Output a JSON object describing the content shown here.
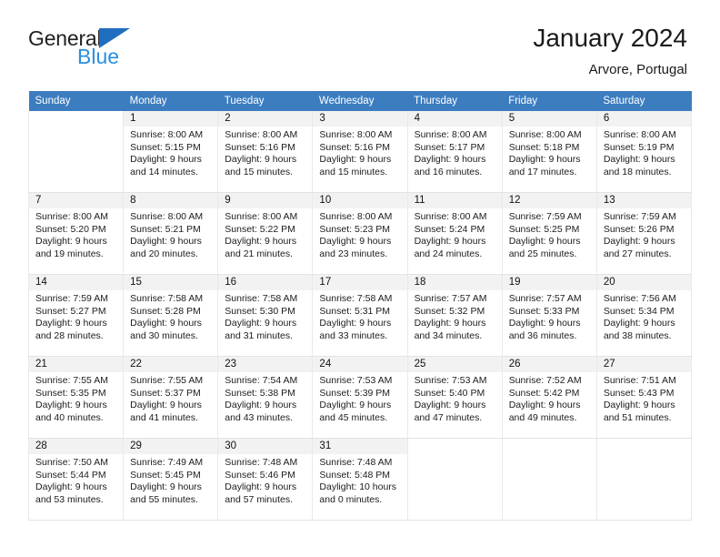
{
  "brand": {
    "name_part1": "General",
    "name_part2": "Blue",
    "logo_icon": "triangle-logo-icon"
  },
  "header": {
    "title": "January 2024",
    "subtitle": "Arvore, Portugal"
  },
  "calendar": {
    "weekday_headers": [
      "Sunday",
      "Monday",
      "Tuesday",
      "Wednesday",
      "Thursday",
      "Friday",
      "Saturday"
    ],
    "accent_color": "#3c7dc0",
    "daynum_band_color": "#f2f2f2",
    "grid_line_color": "#e9e9e9",
    "weeks": [
      [
        {
          "empty": true
        },
        {
          "day": "1",
          "sunrise": "Sunrise: 8:00 AM",
          "sunset": "Sunset: 5:15 PM",
          "daylight1": "Daylight: 9 hours",
          "daylight2": "and 14 minutes."
        },
        {
          "day": "2",
          "sunrise": "Sunrise: 8:00 AM",
          "sunset": "Sunset: 5:16 PM",
          "daylight1": "Daylight: 9 hours",
          "daylight2": "and 15 minutes."
        },
        {
          "day": "3",
          "sunrise": "Sunrise: 8:00 AM",
          "sunset": "Sunset: 5:16 PM",
          "daylight1": "Daylight: 9 hours",
          "daylight2": "and 15 minutes."
        },
        {
          "day": "4",
          "sunrise": "Sunrise: 8:00 AM",
          "sunset": "Sunset: 5:17 PM",
          "daylight1": "Daylight: 9 hours",
          "daylight2": "and 16 minutes."
        },
        {
          "day": "5",
          "sunrise": "Sunrise: 8:00 AM",
          "sunset": "Sunset: 5:18 PM",
          "daylight1": "Daylight: 9 hours",
          "daylight2": "and 17 minutes."
        },
        {
          "day": "6",
          "sunrise": "Sunrise: 8:00 AM",
          "sunset": "Sunset: 5:19 PM",
          "daylight1": "Daylight: 9 hours",
          "daylight2": "and 18 minutes."
        }
      ],
      [
        {
          "day": "7",
          "sunrise": "Sunrise: 8:00 AM",
          "sunset": "Sunset: 5:20 PM",
          "daylight1": "Daylight: 9 hours",
          "daylight2": "and 19 minutes."
        },
        {
          "day": "8",
          "sunrise": "Sunrise: 8:00 AM",
          "sunset": "Sunset: 5:21 PM",
          "daylight1": "Daylight: 9 hours",
          "daylight2": "and 20 minutes."
        },
        {
          "day": "9",
          "sunrise": "Sunrise: 8:00 AM",
          "sunset": "Sunset: 5:22 PM",
          "daylight1": "Daylight: 9 hours",
          "daylight2": "and 21 minutes."
        },
        {
          "day": "10",
          "sunrise": "Sunrise: 8:00 AM",
          "sunset": "Sunset: 5:23 PM",
          "daylight1": "Daylight: 9 hours",
          "daylight2": "and 23 minutes."
        },
        {
          "day": "11",
          "sunrise": "Sunrise: 8:00 AM",
          "sunset": "Sunset: 5:24 PM",
          "daylight1": "Daylight: 9 hours",
          "daylight2": "and 24 minutes."
        },
        {
          "day": "12",
          "sunrise": "Sunrise: 7:59 AM",
          "sunset": "Sunset: 5:25 PM",
          "daylight1": "Daylight: 9 hours",
          "daylight2": "and 25 minutes."
        },
        {
          "day": "13",
          "sunrise": "Sunrise: 7:59 AM",
          "sunset": "Sunset: 5:26 PM",
          "daylight1": "Daylight: 9 hours",
          "daylight2": "and 27 minutes."
        }
      ],
      [
        {
          "day": "14",
          "sunrise": "Sunrise: 7:59 AM",
          "sunset": "Sunset: 5:27 PM",
          "daylight1": "Daylight: 9 hours",
          "daylight2": "and 28 minutes."
        },
        {
          "day": "15",
          "sunrise": "Sunrise: 7:58 AM",
          "sunset": "Sunset: 5:28 PM",
          "daylight1": "Daylight: 9 hours",
          "daylight2": "and 30 minutes."
        },
        {
          "day": "16",
          "sunrise": "Sunrise: 7:58 AM",
          "sunset": "Sunset: 5:30 PM",
          "daylight1": "Daylight: 9 hours",
          "daylight2": "and 31 minutes."
        },
        {
          "day": "17",
          "sunrise": "Sunrise: 7:58 AM",
          "sunset": "Sunset: 5:31 PM",
          "daylight1": "Daylight: 9 hours",
          "daylight2": "and 33 minutes."
        },
        {
          "day": "18",
          "sunrise": "Sunrise: 7:57 AM",
          "sunset": "Sunset: 5:32 PM",
          "daylight1": "Daylight: 9 hours",
          "daylight2": "and 34 minutes."
        },
        {
          "day": "19",
          "sunrise": "Sunrise: 7:57 AM",
          "sunset": "Sunset: 5:33 PM",
          "daylight1": "Daylight: 9 hours",
          "daylight2": "and 36 minutes."
        },
        {
          "day": "20",
          "sunrise": "Sunrise: 7:56 AM",
          "sunset": "Sunset: 5:34 PM",
          "daylight1": "Daylight: 9 hours",
          "daylight2": "and 38 minutes."
        }
      ],
      [
        {
          "day": "21",
          "sunrise": "Sunrise: 7:55 AM",
          "sunset": "Sunset: 5:35 PM",
          "daylight1": "Daylight: 9 hours",
          "daylight2": "and 40 minutes."
        },
        {
          "day": "22",
          "sunrise": "Sunrise: 7:55 AM",
          "sunset": "Sunset: 5:37 PM",
          "daylight1": "Daylight: 9 hours",
          "daylight2": "and 41 minutes."
        },
        {
          "day": "23",
          "sunrise": "Sunrise: 7:54 AM",
          "sunset": "Sunset: 5:38 PM",
          "daylight1": "Daylight: 9 hours",
          "daylight2": "and 43 minutes."
        },
        {
          "day": "24",
          "sunrise": "Sunrise: 7:53 AM",
          "sunset": "Sunset: 5:39 PM",
          "daylight1": "Daylight: 9 hours",
          "daylight2": "and 45 minutes."
        },
        {
          "day": "25",
          "sunrise": "Sunrise: 7:53 AM",
          "sunset": "Sunset: 5:40 PM",
          "daylight1": "Daylight: 9 hours",
          "daylight2": "and 47 minutes."
        },
        {
          "day": "26",
          "sunrise": "Sunrise: 7:52 AM",
          "sunset": "Sunset: 5:42 PM",
          "daylight1": "Daylight: 9 hours",
          "daylight2": "and 49 minutes."
        },
        {
          "day": "27",
          "sunrise": "Sunrise: 7:51 AM",
          "sunset": "Sunset: 5:43 PM",
          "daylight1": "Daylight: 9 hours",
          "daylight2": "and 51 minutes."
        }
      ],
      [
        {
          "day": "28",
          "sunrise": "Sunrise: 7:50 AM",
          "sunset": "Sunset: 5:44 PM",
          "daylight1": "Daylight: 9 hours",
          "daylight2": "and 53 minutes."
        },
        {
          "day": "29",
          "sunrise": "Sunrise: 7:49 AM",
          "sunset": "Sunset: 5:45 PM",
          "daylight1": "Daylight: 9 hours",
          "daylight2": "and 55 minutes."
        },
        {
          "day": "30",
          "sunrise": "Sunrise: 7:48 AM",
          "sunset": "Sunset: 5:46 PM",
          "daylight1": "Daylight: 9 hours",
          "daylight2": "and 57 minutes."
        },
        {
          "day": "31",
          "sunrise": "Sunrise: 7:48 AM",
          "sunset": "Sunset: 5:48 PM",
          "daylight1": "Daylight: 10 hours",
          "daylight2": "and 0 minutes."
        },
        {
          "empty": true
        },
        {
          "empty": true
        },
        {
          "empty": true
        }
      ]
    ]
  }
}
